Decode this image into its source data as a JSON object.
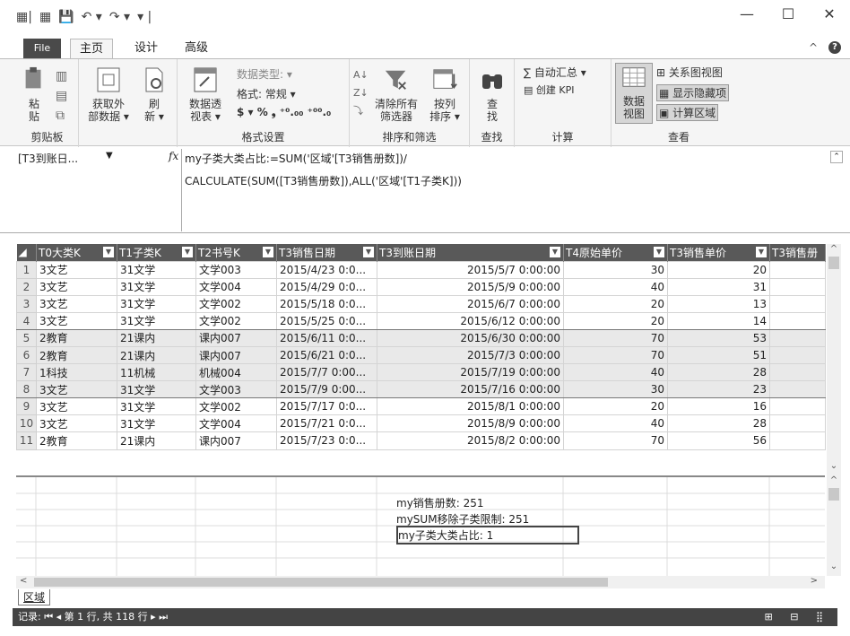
{
  "window": {
    "minimize": "—",
    "maximize": "☐",
    "close": "✕"
  },
  "tabs": {
    "file": "File",
    "home": "主页",
    "design": "设计",
    "advanced": "高级"
  },
  "ribbon": {
    "clipboard": {
      "paste": "粘\n贴",
      "label": "剪贴板"
    },
    "get_external": {
      "label_line1": "获取外",
      "label_line2": "部数据 ▾"
    },
    "refresh": {
      "label_line1": "刷",
      "label_line2": "新 ▾"
    },
    "pivot": {
      "label_line1": "数据透",
      "label_line2": "视表 ▾"
    },
    "format": {
      "data_type": "数据类型: ▾",
      "format": "格式: 常规 ▾",
      "currency": "$ ▾ % ❟ ⁺⁰.₀₀ ⁺⁰⁰.₀",
      "label": "格式设置"
    },
    "sort": {
      "clear_filters": "清除所有",
      "clear_filters2": "筛选器",
      "sort_col": "按列",
      "sort_col2": "排序 ▾",
      "label": "排序和筛选"
    },
    "find": {
      "btn1": "查",
      "btn2": "找",
      "label": "查找"
    },
    "calc": {
      "autosum": "∑ 自动汇总 ▾",
      "kpi": "创建 KPI",
      "label": "计算"
    },
    "view": {
      "data_view1": "数据",
      "data_view2": "视图",
      "diagram": "关系图视图",
      "show_hidden": "显示隐藏项",
      "calc_area": "计算区域",
      "label": "查看"
    }
  },
  "formula_bar": {
    "name": "[T3到账日...",
    "fx": "fx",
    "line1": "my子类大类占比:=SUM('区域'[T3销售册数])/",
    "line2": "CALCULATE(SUM([T3销售册数]),ALL('区域'[T1子类K]))"
  },
  "table": {
    "headers": [
      "T0大类K",
      "T1子类K",
      "T2书号K",
      "T3销售日期",
      "T3到账日期",
      "T4原始单价",
      "T3销售单价",
      "T3销售册"
    ],
    "rows": [
      [
        "1",
        "3文艺",
        "31文学",
        "文学003",
        "2015/4/23 0:0...",
        "2015/5/7 0:00:00",
        "30",
        "20"
      ],
      [
        "2",
        "3文艺",
        "31文学",
        "文学004",
        "2015/4/29 0:0...",
        "2015/5/9 0:00:00",
        "40",
        "31"
      ],
      [
        "3",
        "3文艺",
        "31文学",
        "文学002",
        "2015/5/18 0:0...",
        "2015/6/7 0:00:00",
        "20",
        "13"
      ],
      [
        "4",
        "3文艺",
        "31文学",
        "文学002",
        "2015/5/25 0:0...",
        "2015/6/12 0:00:00",
        "20",
        "14"
      ],
      [
        "5",
        "2教育",
        "21课内",
        "课内007",
        "2015/6/11 0:0...",
        "2015/6/30 0:00:00",
        "70",
        "53"
      ],
      [
        "6",
        "2教育",
        "21课内",
        "课内007",
        "2015/6/21 0:0...",
        "2015/7/3 0:00:00",
        "70",
        "51"
      ],
      [
        "7",
        "1科技",
        "11机械",
        "机械004",
        "2015/7/7 0:00...",
        "2015/7/19 0:00:00",
        "40",
        "28"
      ],
      [
        "8",
        "3文艺",
        "31文学",
        "文学003",
        "2015/7/9 0:00...",
        "2015/7/16 0:00:00",
        "30",
        "23"
      ],
      [
        "9",
        "3文艺",
        "31文学",
        "文学002",
        "2015/7/17 0:0...",
        "2015/8/1 0:00:00",
        "20",
        "16"
      ],
      [
        "10",
        "3文艺",
        "31文学",
        "文学004",
        "2015/7/21 0:0...",
        "2015/8/9 0:00:00",
        "40",
        "28"
      ],
      [
        "11",
        "2教育",
        "21课内",
        "课内007",
        "2015/7/23 0:0...",
        "2015/8/2 0:00:00",
        "70",
        "56"
      ]
    ]
  },
  "measures": {
    "m1": "my销售册数: 251",
    "m2": "mySUM移除子类限制: 251",
    "m3": "my子类大类占比: 1"
  },
  "sheet_tab": "区域",
  "status": {
    "record": "记录:",
    "nav": "⏮ ◂",
    "pos": "第 1 行, 共 118 行",
    "nav2": "▸ ⏭"
  }
}
